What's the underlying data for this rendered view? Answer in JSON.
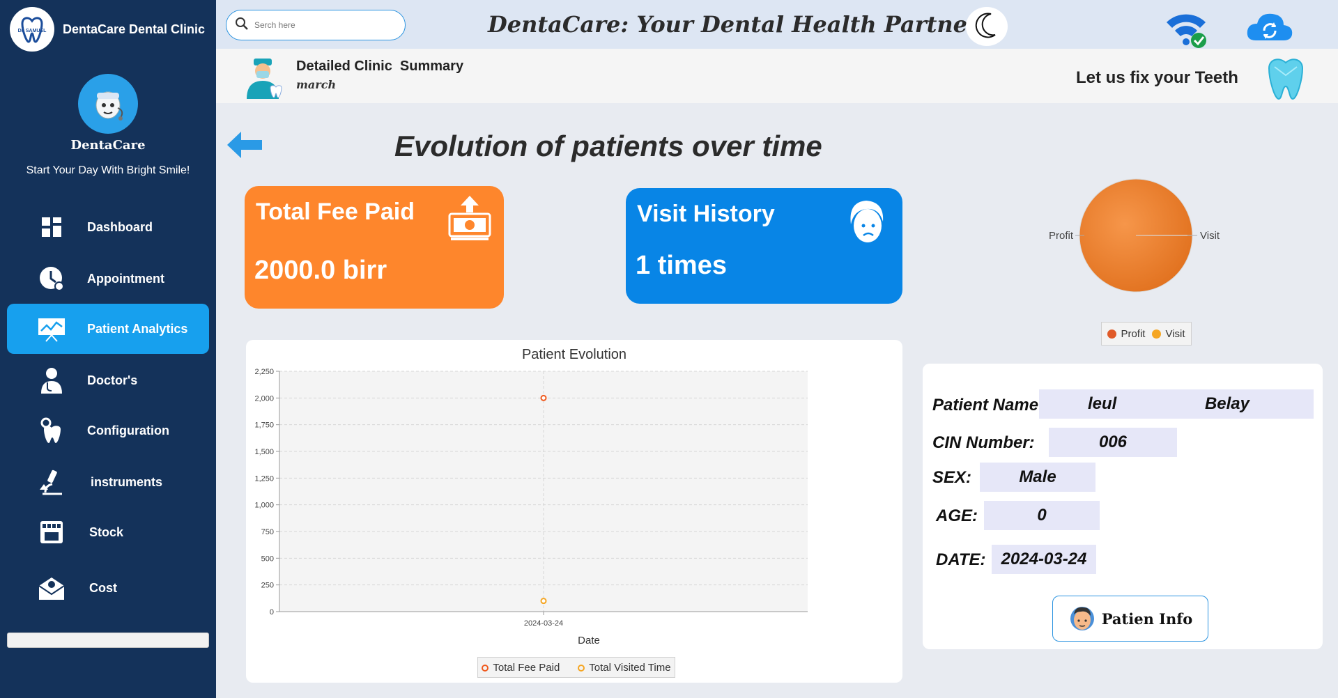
{
  "brand": {
    "name": "DentaCare Dental Clinic",
    "logo_text": "Dr. SAMUEL"
  },
  "profile": {
    "name": "DentaCare",
    "tagline": "Start Your Day With Bright Smile!"
  },
  "nav": [
    {
      "label": "Dashboard",
      "icon": "dashboard-icon"
    },
    {
      "label": "Appointment",
      "icon": "clock-icon"
    },
    {
      "label": "Patient Analytics",
      "icon": "analytics-icon",
      "active": true
    },
    {
      "label": "Doctor's",
      "icon": "doctor-icon"
    },
    {
      "label": "Configuration",
      "icon": "tooth-gear-icon"
    },
    {
      "label": "instruments",
      "icon": "microscope-icon"
    },
    {
      "label": "Stock",
      "icon": "store-icon"
    },
    {
      "label": "Cost",
      "icon": "envelope-icon"
    }
  ],
  "header": {
    "search_placeholder": "Serch here",
    "title": "DentaCare: Your Dental Health Partner"
  },
  "subheader": {
    "title": "Detailed Clinic  Summary",
    "month": "march",
    "slogan": "Let us fix your Teeth"
  },
  "page": {
    "title": "Evolution of patients over time"
  },
  "cards": {
    "fee": {
      "title": "Total Fee Paid",
      "value": "2000.0 birr"
    },
    "visit": {
      "title": "Visit History",
      "value": "1 times"
    }
  },
  "pie": {
    "labels": [
      "Profit",
      "Visit"
    ],
    "legend": [
      "Profit",
      "Visit"
    ]
  },
  "chart_data": [
    {
      "type": "pie",
      "categories": [
        "Profit",
        "Visit"
      ],
      "values": [
        2000,
        1
      ],
      "colors": [
        "#ee7a28",
        "#f5a623"
      ],
      "legend": "bottom"
    },
    {
      "type": "scatter",
      "title": "Patient Evolution",
      "xlabel": "Date",
      "ylabel": "",
      "x": [
        "2024-03-24"
      ],
      "series": [
        {
          "name": "Total Fee Paid",
          "values": [
            2000
          ],
          "color": "#f05a1e"
        },
        {
          "name": "Total Visited Time",
          "values": [
            100
          ],
          "color": "#f5a623"
        }
      ],
      "ylim": [
        0,
        2250
      ],
      "yticks": [
        "0",
        "250",
        "500",
        "750",
        "1,000",
        "1,250",
        "1,500",
        "1,750",
        "2,000",
        "2,250"
      ],
      "grid": true,
      "legend": "bottom"
    }
  ],
  "patient": {
    "name_label": "Patient Name:",
    "first_name": "leul",
    "last_name": "Belay",
    "cin_label": "CIN Number:",
    "cin": "006",
    "sex_label": "SEX:",
    "sex": "Male",
    "age_label": "AGE:",
    "age": "0",
    "date_label": "DATE:",
    "date": "2024-03-24",
    "button_label": "Patien Info"
  },
  "colors": {
    "sidebar": "#14325a",
    "active_nav": "#17a0ee",
    "fee_card": "#fe862c",
    "visit_card": "#0885e6"
  }
}
